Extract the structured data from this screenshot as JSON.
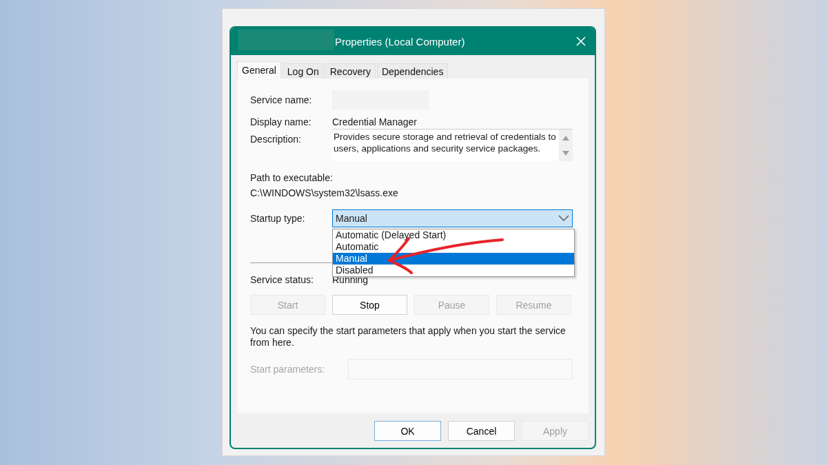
{
  "window": {
    "title": "Properties (Local Computer)",
    "title_redacted": true
  },
  "tabs": [
    {
      "label": "General",
      "selected": true
    },
    {
      "label": "Log On",
      "selected": false
    },
    {
      "label": "Recovery",
      "selected": false
    },
    {
      "label": "Dependencies",
      "selected": false
    }
  ],
  "service_name": {
    "label": "Service name:",
    "redacted": true
  },
  "display_name": {
    "label": "Display name:",
    "value": "Credential Manager"
  },
  "description": {
    "label": "Description:",
    "value": "Provides secure storage and retrieval of credentials to users, applications and security service packages."
  },
  "path": {
    "label": "Path to executable:",
    "value": "C:\\WINDOWS\\system32\\lsass.exe"
  },
  "startup_type": {
    "label": "Startup type:",
    "value": "Manual",
    "expanded": true,
    "options": [
      {
        "label": "Automatic (Delayed Start)",
        "selected": false
      },
      {
        "label": "Automatic",
        "selected": false
      },
      {
        "label": "Manual",
        "selected": true
      },
      {
        "label": "Disabled",
        "selected": false
      }
    ]
  },
  "service_status": {
    "label": "Service status:",
    "value": "Running"
  },
  "service_buttons": [
    {
      "label": "Start",
      "disabled": true
    },
    {
      "label": "Stop",
      "disabled": false
    },
    {
      "label": "Pause",
      "disabled": true
    },
    {
      "label": "Resume",
      "disabled": true
    }
  ],
  "hint": "You can specify the start parameters that apply when you start the service from here.",
  "start_parameters": {
    "label": "Start parameters:",
    "disabled": true
  },
  "footer_buttons": [
    {
      "label": "OK",
      "disabled": false,
      "default": true
    },
    {
      "label": "Cancel",
      "disabled": false,
      "default": false
    },
    {
      "label": "Apply",
      "disabled": true,
      "default": false
    }
  ]
}
